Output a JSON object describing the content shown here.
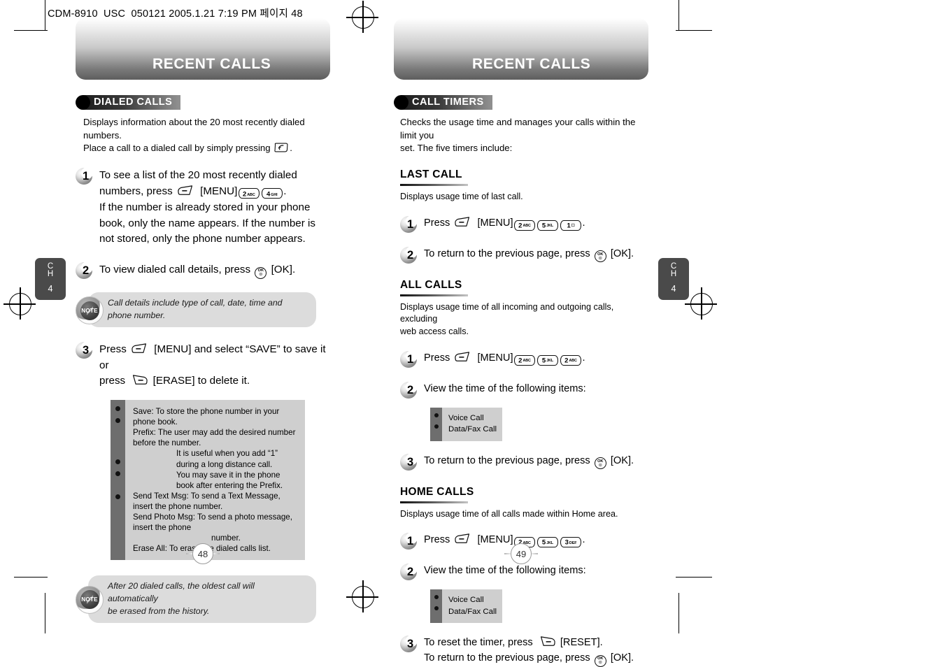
{
  "file_header": "CDM-8910_USC_050121  2005.1.21 7:19 PM  페이지 48",
  "left_page": {
    "banner_title": "RECENT CALLS",
    "section": {
      "label": "DIALED CALLS"
    },
    "intro_line1": "Displays information about the 20 most recently dialed numbers.",
    "intro_line2_a": "Place a call to a dialed call by simply pressing",
    "intro_line2_b": ".",
    "steps": [
      {
        "num": "1",
        "line1_a": "To see a list of the 20 most recently dialed",
        "line2_a": "numbers, press",
        "line2_menu": "[MENU]",
        "line2_end": ".",
        "line3": "If the number is already stored in your phone",
        "line4": "book, only the name appears. If the number is",
        "line5": "not stored, only the phone number appears.",
        "keys": [
          {
            "digit": "2",
            "letters": "ABC"
          },
          {
            "digit": "4",
            "letters": "GHI"
          }
        ]
      },
      {
        "num": "2",
        "line1_a": "To view dialed call details, press",
        "line1_b": "[OK]."
      },
      {
        "num": "3",
        "line1_a": "Press",
        "line1_menu": "[MENU]",
        "line1_b": "and select “SAVE” to save it or",
        "line2_a": "press",
        "line2_b": "[ERASE] to delete it."
      }
    ],
    "note1": "Call details include type of call, date, time and phone number.",
    "note2_line1": "After 20 dialed calls, the oldest call will automatically",
    "note2_line2": "be erased from the history.",
    "infobox_lines": [
      {
        "bullet": true,
        "text": "Save: To store the phone number in your phone book.",
        "indent": 0
      },
      {
        "bullet": true,
        "text": "Prefix: The user may add the desired number before the number.",
        "indent": 0
      },
      {
        "bullet": false,
        "text": "It is useful when you add “1” during a long distance call.",
        "indent": 1
      },
      {
        "bullet": false,
        "text": "You may save it in the phone book after entering the Prefix.",
        "indent": 1
      },
      {
        "bullet": true,
        "text": "Send Text Msg: To send a Text Message, insert the phone number.",
        "indent": 0
      },
      {
        "bullet": true,
        "text": "Send Photo Msg: To send a photo message, insert the phone",
        "indent": 0
      },
      {
        "bullet": false,
        "text": "number.",
        "indent": 2
      },
      {
        "bullet": true,
        "text": "Erase All: To erase the dialed calls list.",
        "indent": 0
      }
    ],
    "chapter_tab": {
      "letters_line1": "C",
      "letters_line2": "H",
      "number": "4"
    },
    "page_number": "48"
  },
  "right_page": {
    "banner_title": "RECENT CALLS",
    "section": {
      "label": "CALL TIMERS"
    },
    "intro_line1": "Checks the usage time and manages your calls within the limit you",
    "intro_line2": "set. The five timers include:",
    "subsections": [
      {
        "title": "LAST CALL",
        "desc": "Displays usage time of last call.",
        "steps": [
          {
            "num": "1",
            "prefix": "Press",
            "menu": "[MENU]",
            "suffix": ".",
            "keys": [
              {
                "digit": "2",
                "letters": "ABC"
              },
              {
                "digit": "5",
                "letters": "JKL"
              },
              {
                "digit": "1",
                "letters": ""
              }
            ]
          },
          {
            "num": "2",
            "prefix": "To return to the previous page, press",
            "suffix": "[OK]."
          }
        ]
      },
      {
        "title": "ALL CALLS",
        "desc_line1": "Displays usage time of all incoming and outgoing calls, excluding",
        "desc_line2": "web access calls.",
        "steps": [
          {
            "num": "1",
            "prefix": "Press",
            "menu": "[MENU]",
            "suffix": ".",
            "keys": [
              {
                "digit": "2",
                "letters": "ABC"
              },
              {
                "digit": "5",
                "letters": "JKL"
              },
              {
                "digit": "2",
                "letters": "ABC"
              }
            ]
          },
          {
            "num": "2",
            "prefix": "View the time of the following items:"
          },
          {
            "num": "3",
            "prefix": "To return to the previous page, press",
            "suffix": "[OK]."
          }
        ],
        "list_items": [
          "Voice Call",
          "Data/Fax Call"
        ]
      },
      {
        "title": "HOME CALLS",
        "desc": "Displays usage time of all calls made within Home area.",
        "steps": [
          {
            "num": "1",
            "prefix": "Press",
            "menu": "[MENU]",
            "suffix": ".",
            "keys": [
              {
                "digit": "2",
                "letters": "ABC"
              },
              {
                "digit": "5",
                "letters": "JKL"
              },
              {
                "digit": "3",
                "letters": "DEF"
              }
            ]
          },
          {
            "num": "2",
            "prefix": "View the time of the following items:"
          },
          {
            "num": "3",
            "line1_a": "To reset the timer, press",
            "line1_b": "[RESET].",
            "line2_a": "To return to the previous page, press",
            "line2_b": "[OK]."
          }
        ],
        "list_items": [
          "Voice Call",
          "Data/Fax Call"
        ]
      }
    ],
    "chapter_tab": {
      "letters_line1": "C",
      "letters_line2": "H",
      "number": "4"
    },
    "page_number": "49"
  },
  "icons": {
    "menu_soft_key": "soft-key-left-icon",
    "erase_soft_key": "soft-key-right-icon",
    "ok_key": "ok-key-icon",
    "send_key": "send-call-key-icon",
    "note_badge": "note-badge-icon"
  },
  "colors": {
    "banner_dark": "#5e5e5e",
    "infobox_body": "#cfcfcf",
    "infobox_strip": "#6e6e6e",
    "note_pill": "#dcdcdc",
    "chapter_tab": "#4a4a4a"
  }
}
